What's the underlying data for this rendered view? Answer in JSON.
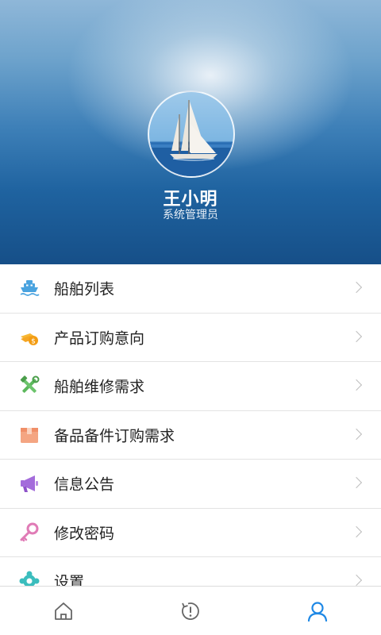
{
  "profile": {
    "name": "王小明",
    "role": "系统管理员"
  },
  "menu": {
    "items": [
      {
        "label": "船舶列表",
        "icon": "ship-icon",
        "color": "#4aa3df"
      },
      {
        "label": "产品订购意向",
        "icon": "coins-icon",
        "color": "#f5a623"
      },
      {
        "label": "船舶维修需求",
        "icon": "tools-icon",
        "color": "#5cb85c"
      },
      {
        "label": "备品备件订购需求",
        "icon": "box-icon",
        "color": "#f4a582"
      },
      {
        "label": "信息公告",
        "icon": "megaphone-icon",
        "color": "#a46cdb"
      },
      {
        "label": "修改密码",
        "icon": "key-icon",
        "color": "#e07bb6"
      },
      {
        "label": "设置",
        "icon": "gear-icon",
        "color": "#3bbdbd"
      }
    ]
  },
  "tabs": [
    {
      "icon": "home-icon",
      "active": false
    },
    {
      "icon": "alert-refresh-icon",
      "active": false
    },
    {
      "icon": "user-icon",
      "active": true,
      "color": "#1e88e5"
    }
  ]
}
